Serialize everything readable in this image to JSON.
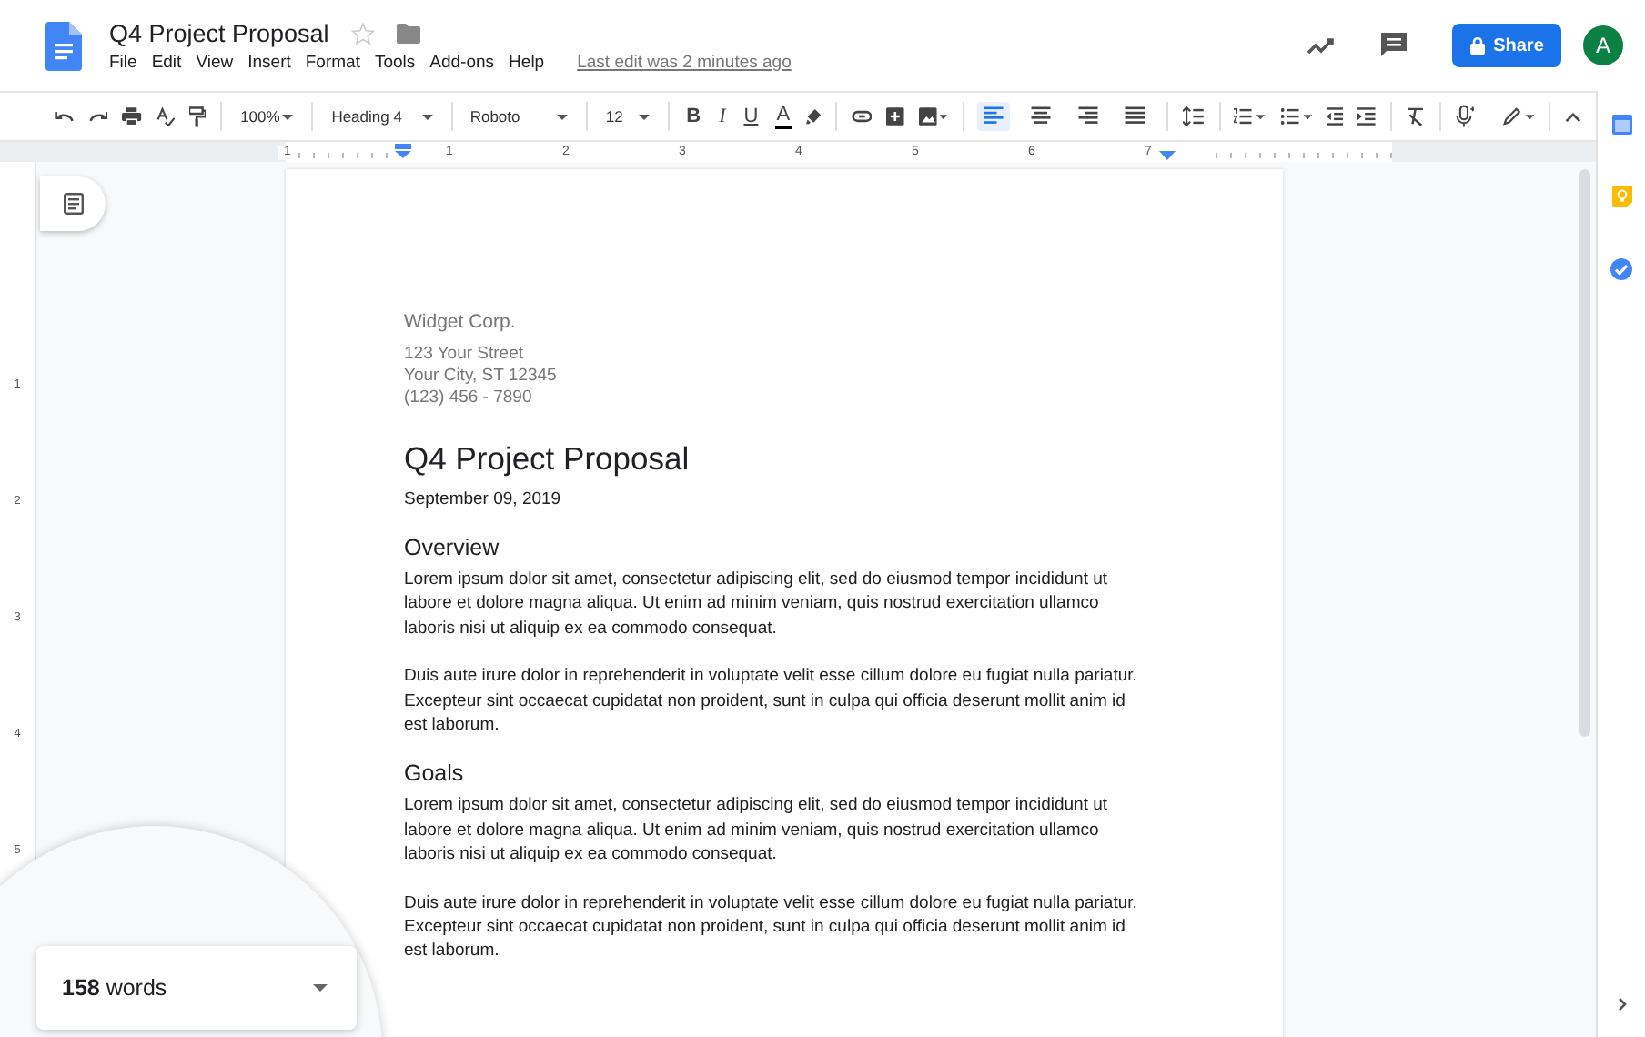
{
  "document": {
    "title": "Q4 Project Proposal",
    "starred": false,
    "last_edit": "Last edit was 2 minutes ago"
  },
  "menu": [
    "File",
    "Edit",
    "View",
    "Insert",
    "Format",
    "Tools",
    "Add-ons",
    "Help"
  ],
  "share_button": "Share",
  "avatar": "A",
  "toolbar": {
    "zoom": "100%",
    "style": "Heading 4",
    "font": "Roboto",
    "size": "12",
    "format_buttons": [
      {
        "kind": "bold",
        "label": "B"
      },
      {
        "kind": "italic",
        "label": "I"
      },
      {
        "kind": "underline",
        "label": "U"
      },
      {
        "kind": "color",
        "label": "A"
      }
    ],
    "alignment": [
      {
        "kind": "left",
        "selected": true
      },
      {
        "kind": "center",
        "selected": false
      },
      {
        "kind": "right",
        "selected": false
      },
      {
        "kind": "justify",
        "selected": false
      }
    ]
  },
  "ruler": {
    "marks": [
      "1",
      "1",
      "2",
      "3",
      "4",
      "5",
      "6",
      "7"
    ],
    "vertical_marks": [
      "1",
      "2",
      "3",
      "4",
      "5"
    ]
  },
  "page": {
    "sender": [
      "Widget Corp.",
      "123 Your Street",
      "Your City, ST 12345",
      "(123) 456 - 7890"
    ],
    "heading": "Q4 Project Proposal",
    "date": "September 09, 2019",
    "sections": [
      {
        "title": "Overview",
        "paragraphs": [
          "Lorem ipsum dolor sit amet, consectetur adipiscing elit, sed do eiusmod tempor incididunt ut labore et dolore magna aliqua. Ut enim ad minim veniam, quis nostrud exercitation ullamco laboris nisi ut aliquip ex ea commodo consequat.",
          "Duis aute irure dolor in reprehenderit in voluptate velit esse cillum dolore eu fugiat nulla pariatur. Excepteur sint occaecat cupidatat non proident, sunt in culpa qui officia deserunt mollit anim id est laborum."
        ]
      },
      {
        "title": "Goals",
        "paragraphs": [
          "Lorem ipsum dolor sit amet, consectetur adipiscing elit, sed do eiusmod tempor incididunt ut labore et dolore magna aliqua. Ut enim ad minim veniam, quis nostrud exercitation ullamco laboris nisi ut aliquip ex ea commodo consequat.",
          "Duis aute irure dolor in reprehenderit in voluptate velit esse cillum dolore eu fugiat nulla pariatur. Excepteur sint occaecat cupidatat non proident, sunt in culpa qui officia deserunt mollit anim id est laborum."
        ]
      }
    ]
  },
  "word_count": "**158** words"
}
